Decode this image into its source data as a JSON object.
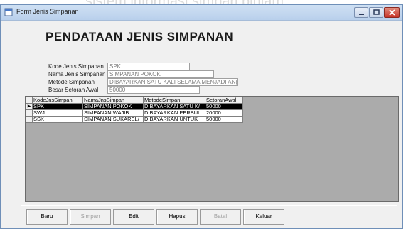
{
  "background_caption": "sistem informasi simpan pinjam",
  "window": {
    "title": "Form Jenis Simpanan"
  },
  "form": {
    "heading": "PENDATAAN JENIS SIMPANAN",
    "fields": [
      {
        "label": "Kode Jenis Simpanan",
        "value": "SPK"
      },
      {
        "label": "Nama Jenis Simpanan",
        "value": "SIMPANAN POKOK"
      },
      {
        "label": "Metode Simpanan",
        "value": "DIBAYARKAN SATU KALI SELAMA MENJADI AN("
      },
      {
        "label": "Besar Setoran Awal",
        "value": "50000"
      }
    ]
  },
  "grid": {
    "columns": [
      "KodeJnsSimpan",
      "NamaJnsSimpan",
      "MetodeSimpan",
      "SetoranAwal"
    ],
    "rows": [
      [
        "SPK",
        "SIMPANAN POKOK",
        "DIBAYARKAN SATU K/",
        "50000"
      ],
      [
        "SWJ",
        "SIMPANAN WAJIB",
        "DIBAYARKAN PERBUL",
        "20000"
      ],
      [
        "SSK",
        "SIMPANAN SUKAREL/",
        "DIBAYARKAN UNTUK",
        "50000"
      ]
    ],
    "current_row_marker": "▶"
  },
  "buttons": [
    {
      "label": "Baru",
      "enabled": true
    },
    {
      "label": "Simpan",
      "enabled": false
    },
    {
      "label": "Edit",
      "enabled": true
    },
    {
      "label": "Hapus",
      "enabled": true
    },
    {
      "label": "Batal",
      "enabled": false
    },
    {
      "label": "Keluar",
      "enabled": true
    }
  ],
  "colors": {
    "selected_row": "#000000",
    "grid_background": "#ababab",
    "titlebar": "#cfe0f3",
    "close_button": "#c8352a"
  }
}
